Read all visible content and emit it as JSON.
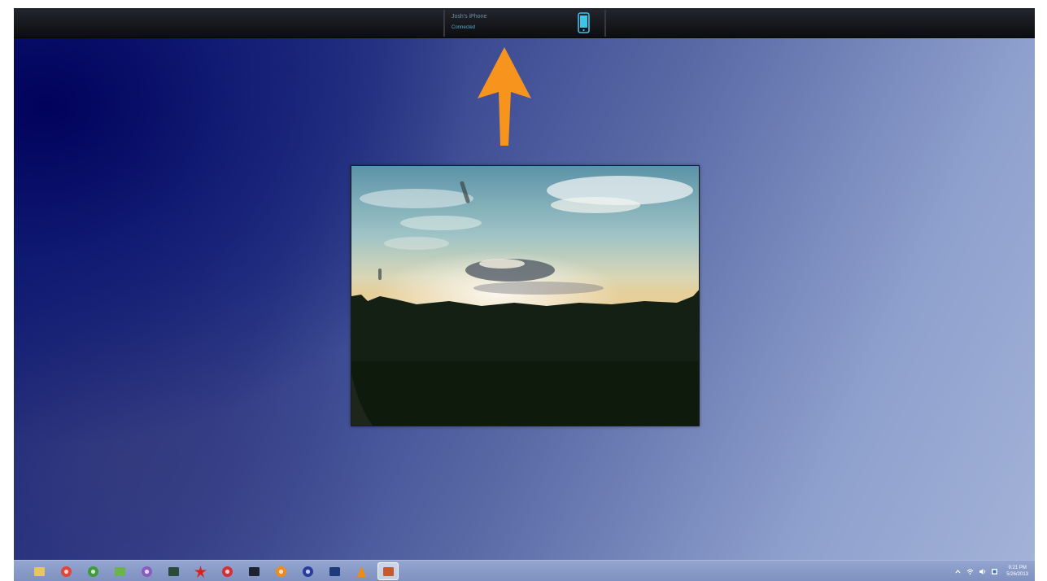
{
  "device_bar": {
    "device_name": "Josh's iPhone",
    "status": "Connected",
    "icon": "phone-icon"
  },
  "annotation": {
    "icon": "up-arrow",
    "color": "#f7941d"
  },
  "photo": {
    "subject": "sunset-sky-over-field"
  },
  "taskbar": {
    "pinned": [
      {
        "name": "file-explorer-icon",
        "color": "#e8c65a"
      },
      {
        "name": "chrome-icon",
        "color": "#e0453a"
      },
      {
        "name": "utorrent-icon",
        "color": "#3d9b3a"
      },
      {
        "name": "image-viewer-icon",
        "color": "#6bb34a"
      },
      {
        "name": "media-player-icon",
        "color": "#8a5cc2"
      },
      {
        "name": "terminal-icon",
        "color": "#2a4a3a"
      },
      {
        "name": "red-star-app-icon",
        "color": "#d8211c"
      },
      {
        "name": "red-app-icon",
        "color": "#d12f3a"
      },
      {
        "name": "dark-window-icon",
        "color": "#1c2430"
      },
      {
        "name": "blender-icon",
        "color": "#f08a1a"
      },
      {
        "name": "globe-app-icon",
        "color": "#2a3c9c"
      },
      {
        "name": "photoshop-icon",
        "color": "#1f3a7a"
      },
      {
        "name": "vlc-icon",
        "color": "#f08b16"
      },
      {
        "name": "active-app-icon",
        "color": "#c8582e"
      }
    ],
    "tray_icons": [
      "show-hidden-icons-chevron",
      "network-icon",
      "volume-icon",
      "action-center-icon"
    ],
    "clock_time": "9:21 PM",
    "clock_date": "5/26/2013"
  }
}
